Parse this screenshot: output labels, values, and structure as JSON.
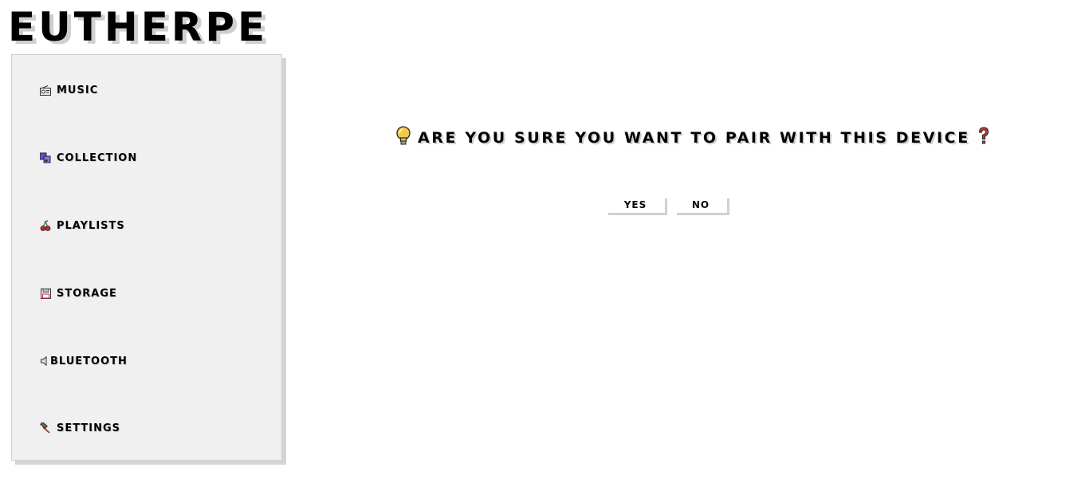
{
  "app": {
    "logo": "EUTHERPE"
  },
  "sidebar": {
    "items": [
      {
        "label": "MUSIC",
        "icon": "radio-icon"
      },
      {
        "label": "COLLECTION",
        "icon": "music-notes-icon"
      },
      {
        "label": "PLAYLISTS",
        "icon": "cherries-icon"
      },
      {
        "label": "STORAGE",
        "icon": "floppy-disk-icon"
      },
      {
        "label": "BLUETOOTH",
        "icon": "speaker-icon"
      },
      {
        "label": "SETTINGS",
        "icon": "hammer-icon"
      }
    ]
  },
  "dialog": {
    "message": "ARE YOU SURE YOU WANT TO PAIR WITH THIS DEVICE",
    "leading_icon": "lightbulb-icon",
    "trailing_icon": "question-mark-icon",
    "yes_label": "YES",
    "no_label": "NO"
  },
  "colors": {
    "sidebar_bg": "#f0f0f0",
    "shadow": "#cfcfcf",
    "text": "#000000",
    "lightbulb": "#f2c94c",
    "question_mark": "#d33a2c"
  }
}
